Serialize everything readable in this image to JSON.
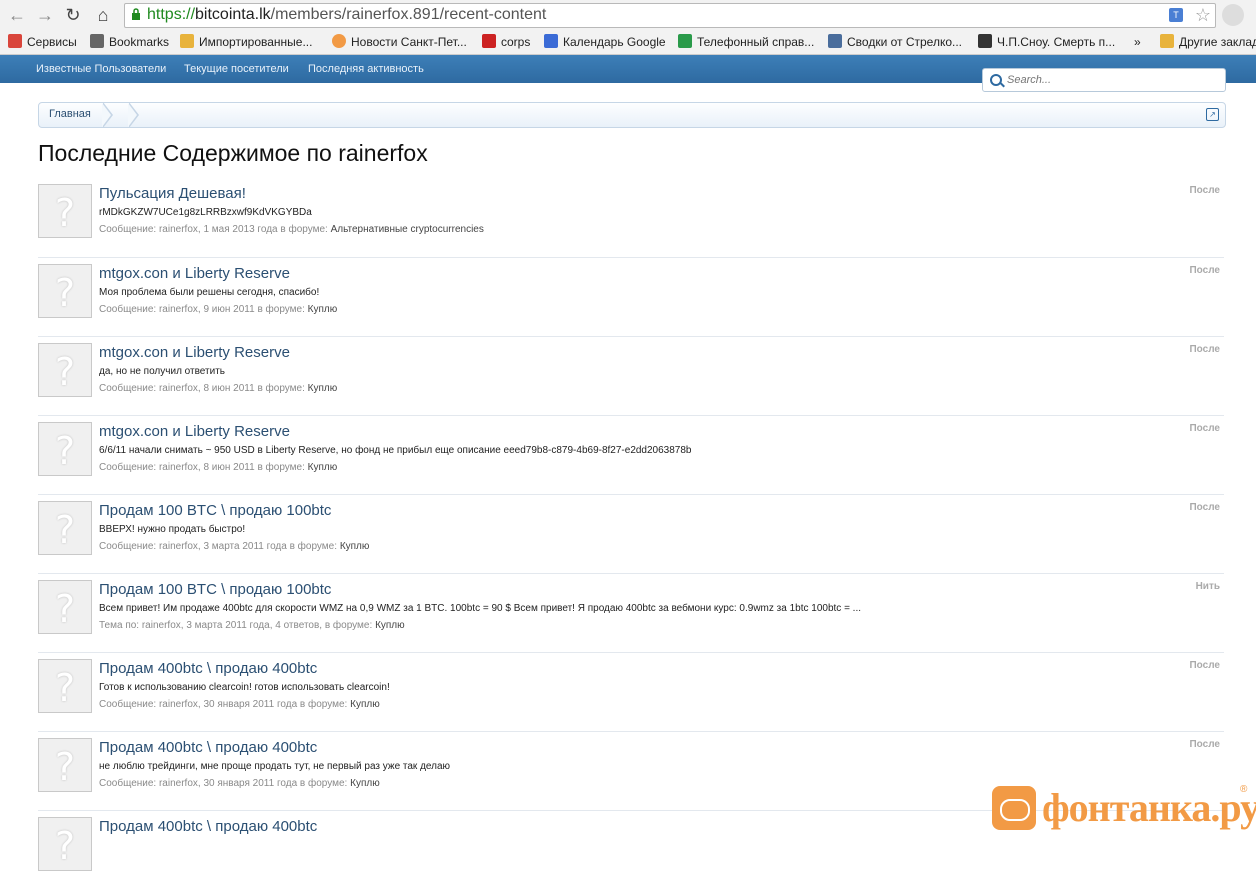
{
  "browser": {
    "url_scheme": "https://",
    "url_host": "bitcointa.lk",
    "url_path": "/members/rainerfox.891/recent-content",
    "bookmarks": [
      {
        "label": "Сервисы",
        "color": "#d9453b"
      },
      {
        "label": "Bookmarks",
        "color": "#666666"
      },
      {
        "label": "Импортированные...",
        "color": "#e8b33c"
      },
      {
        "label": "Новости Санкт-Пет...",
        "color": "#f29a45"
      },
      {
        "label": "corps",
        "color": "#cc2222"
      },
      {
        "label": "Календарь Google",
        "color": "#3b6bd6"
      },
      {
        "label": "Телефонный справ...",
        "color": "#2a9a4a"
      },
      {
        "label": "Сводки от Стрелко...",
        "color": "#4a6d9c"
      },
      {
        "label": "Ч.П.Сноу. Смерть п...",
        "color": "#333333"
      },
      {
        "label": "»",
        "color": ""
      },
      {
        "label": "Другие заклад",
        "color": "#e8b33c"
      }
    ]
  },
  "site_nav": {
    "links": [
      "Известные Пользователи",
      "Текущие посетители",
      "Последняя активность"
    ],
    "search_placeholder": "Search..."
  },
  "breadcrumb": {
    "home": "Главная"
  },
  "page_title": "Последние Содержимое по rainerfox",
  "items": [
    {
      "title": "Пульсация Дешевая!",
      "snippet": "rMDkGKZW7UCe1g8zLRRBzxwf9KdVKGYBDa",
      "meta": "Сообщение: rainerfox, 1 мая 2013 года в форуме: ",
      "forum": "Альтернативные cryptocurrencies",
      "type": "После"
    },
    {
      "title": "mtgox.con и Liberty Reserve",
      "snippet": "Моя проблема были решены сегодня, спасибо!",
      "meta": "Сообщение: rainerfox, 9 июн 2011 в форуме: ",
      "forum": "Куплю",
      "type": "После"
    },
    {
      "title": "mtgox.con и Liberty Reserve",
      "snippet": "да, но не получил ответить",
      "meta": "Сообщение: rainerfox, 8 июн 2011 в форуме: ",
      "forum": "Куплю",
      "type": "После"
    },
    {
      "title": "mtgox.con и Liberty Reserve",
      "snippet": "6/6/11 начали снимать ~ 950 USD в Liberty Reserve, но фонд не прибыл еще описание eeed79b8-c879-4b69-8f27-e2dd2063878b",
      "meta": "Сообщение: rainerfox, 8 июн 2011 в форуме: ",
      "forum": "Куплю",
      "type": "После"
    },
    {
      "title": "Продам 100 BTC \\ продаю 100btc",
      "snippet": "ВВЕРХ! нужно продать быстро!",
      "meta": "Сообщение: rainerfox, 3 марта 2011 года в форуме: ",
      "forum": "Куплю",
      "type": "После"
    },
    {
      "title": "Продам 100 BTC \\ продаю 100btc",
      "snippet": "Всем привет! Им продаже 400btc для скорости WMZ на 0,9 WMZ за 1 BTC. 100btc = 90 $ Всем привет! Я продаю 400btc за вебмони курс: 0.9wmz за 1btc 100btc = ...",
      "meta": "Тема по: rainerfox, 3 марта 2011 года, 4 ответов, в форуме: ",
      "forum": "Куплю",
      "type": "Нить"
    },
    {
      "title": "Продам 400btc \\ продаю 400btc",
      "snippet": "Готов к использованию clearcoin! готов использовать clearcoin!",
      "meta": "Сообщение: rainerfox, 30 января 2011 года в форуме: ",
      "forum": "Куплю",
      "type": "После"
    },
    {
      "title": "Продам 400btc \\ продаю 400btc",
      "snippet": "не люблю трейдинги, мне проще продать тут, не первый раз уже так делаю",
      "meta": "Сообщение: rainerfox, 30 января 2011 года в форуме: ",
      "forum": "Куплю",
      "type": "После"
    },
    {
      "title": "Продам 400btc \\ продаю 400btc",
      "snippet": "",
      "meta": "",
      "forum": "",
      "type": ""
    }
  ],
  "watermark": {
    "text": "фонтанка.ру",
    "reg": "®"
  }
}
